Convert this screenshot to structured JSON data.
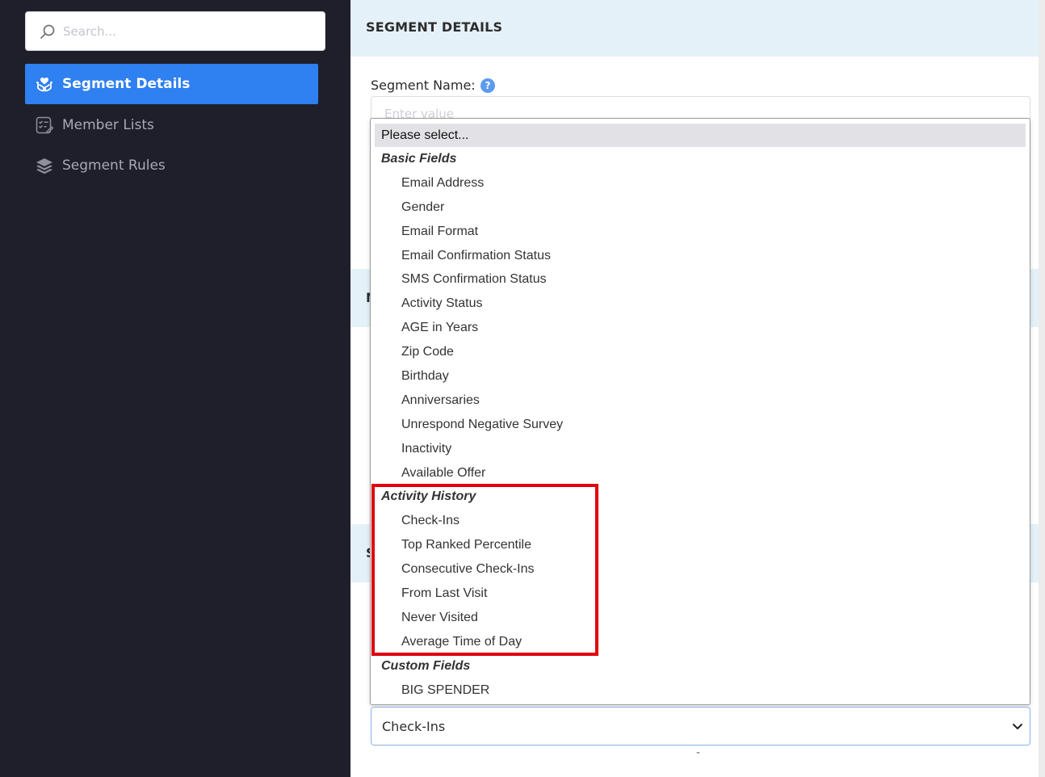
{
  "sidebar": {
    "search": {
      "placeholder": "Search..."
    },
    "items": [
      {
        "label": "Segment Details",
        "icon": "hands-heart-icon",
        "active": true
      },
      {
        "label": "Member Lists",
        "icon": "checklist-icon",
        "active": false
      },
      {
        "label": "Segment Rules",
        "icon": "layers-icon",
        "active": false
      }
    ]
  },
  "main": {
    "section_title": "SEGMENT DETAILS",
    "segment_name_label": "Segment Name:",
    "segment_name_placeholder": "Enter value",
    "hidden_header_2_letter": "M",
    "hidden_header_3_letter": "S"
  },
  "dropdown": {
    "placeholder": "Please select...",
    "groups": [
      {
        "label": "Basic Fields",
        "options": [
          "Email Address",
          "Gender",
          "Email Format",
          "Email Confirmation Status",
          "SMS Confirmation Status",
          "Activity Status",
          "AGE in Years",
          "Zip Code",
          "Birthday",
          "Anniversaries",
          "Unrespond Negative Survey",
          "Inactivity",
          "Available Offer"
        ]
      },
      {
        "label": "Activity History",
        "options": [
          "Check-Ins",
          "Top Ranked Percentile",
          "Consecutive Check-Ins",
          "From Last Visit",
          "Never Visited",
          "Average Time of Day"
        ]
      },
      {
        "label": "Custom Fields",
        "options": [
          "BIG SPENDER"
        ]
      }
    ]
  },
  "select": {
    "value": "Check-Ins"
  },
  "colors": {
    "sidebar_bg": "#1f1f2c",
    "accent": "#2f80f0",
    "header_bg": "#e5f1f9",
    "highlight": "#e0000e"
  }
}
